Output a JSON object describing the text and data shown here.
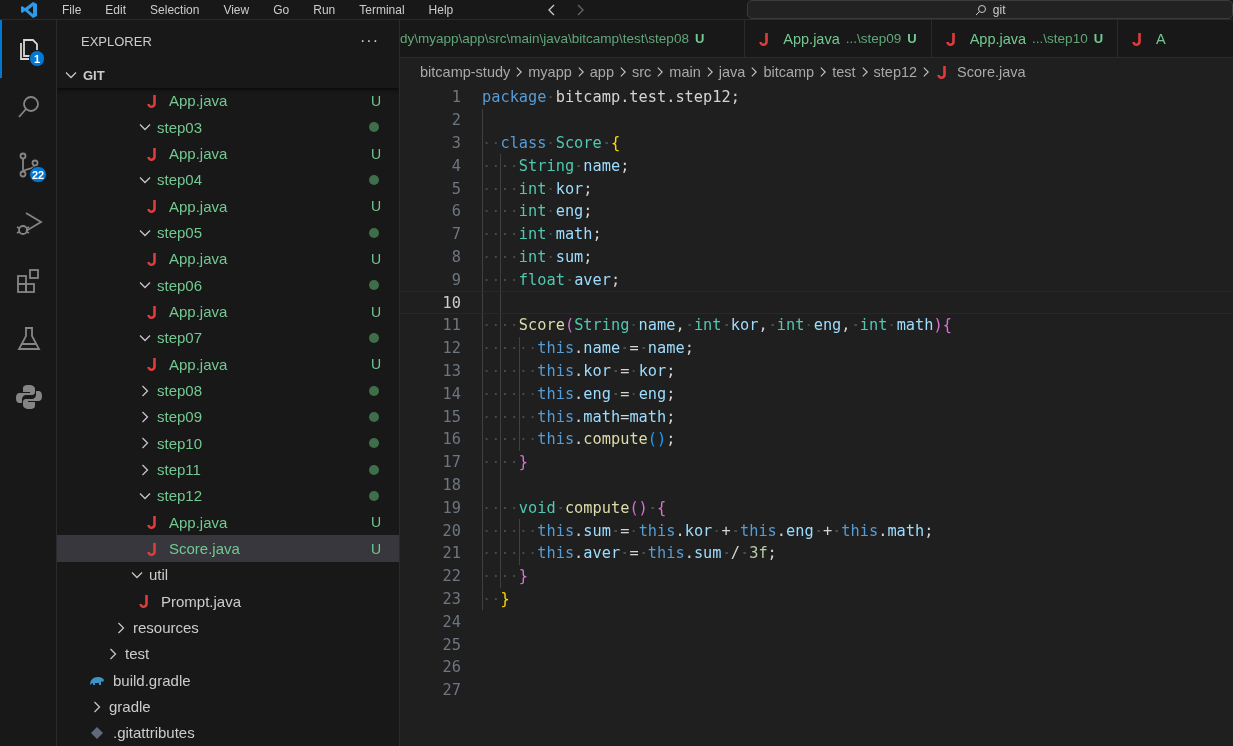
{
  "menu": [
    "File",
    "Edit",
    "Selection",
    "View",
    "Go",
    "Run",
    "Terminal",
    "Help"
  ],
  "search": {
    "value": "git"
  },
  "activity": [
    {
      "kind": "explorer",
      "selected": true,
      "badge": "1"
    },
    {
      "kind": "search",
      "selected": false
    },
    {
      "kind": "source-control",
      "selected": false,
      "badge": "22"
    },
    {
      "kind": "run",
      "selected": false
    },
    {
      "kind": "extensions",
      "selected": false
    },
    {
      "kind": "testing",
      "selected": false
    },
    {
      "kind": "python",
      "selected": false
    }
  ],
  "sidebar": {
    "title": "EXPLORER",
    "more": "···",
    "section": {
      "label": "GIT",
      "expanded": true
    },
    "tree": [
      {
        "children": [
          {
            "children": [
              {
                "children": [
                  {
                    "children": [
                      {
                        "children": [
                          {
                            "children": [
                              {
                                "children": [
                                  {
                                    "name": "App.java",
                                    "kind": "java",
                                    "untracked": true,
                                    "badge": "U",
                                    "selected": false
                                  }
                                ]
                              },
                              {
                                "name": "step03",
                                "kind": "folder",
                                "expanded": true,
                                "untracked": true,
                                "modified": true,
                                "selected": false,
                                "children": [
                                  {
                                    "name": "App.java",
                                    "kind": "java",
                                    "untracked": true,
                                    "badge": "U",
                                    "selected": false
                                  }
                                ]
                              },
                              {
                                "name": "step04",
                                "kind": "folder",
                                "expanded": true,
                                "untracked": true,
                                "modified": true,
                                "selected": false,
                                "children": [
                                  {
                                    "name": "App.java",
                                    "kind": "java",
                                    "untracked": true,
                                    "badge": "U",
                                    "selected": false
                                  }
                                ]
                              },
                              {
                                "name": "step05",
                                "kind": "folder",
                                "expanded": true,
                                "untracked": true,
                                "modified": true,
                                "selected": false,
                                "children": [
                                  {
                                    "name": "App.java",
                                    "kind": "java",
                                    "untracked": true,
                                    "badge": "U",
                                    "selected": false
                                  }
                                ]
                              },
                              {
                                "name": "step06",
                                "kind": "folder",
                                "expanded": true,
                                "untracked": true,
                                "modified": true,
                                "selected": false,
                                "children": [
                                  {
                                    "name": "App.java",
                                    "kind": "java",
                                    "untracked": true,
                                    "badge": "U",
                                    "selected": false
                                  }
                                ]
                              },
                              {
                                "name": "step07",
                                "kind": "folder",
                                "expanded": true,
                                "untracked": true,
                                "modified": true,
                                "selected": false,
                                "children": [
                                  {
                                    "name": "App.java",
                                    "kind": "java",
                                    "untracked": true,
                                    "badge": "U",
                                    "selected": false
                                  }
                                ]
                              },
                              {
                                "name": "step08",
                                "kind": "folder",
                                "expanded": false,
                                "untracked": true,
                                "modified": true,
                                "selected": false
                              },
                              {
                                "name": "step09",
                                "kind": "folder",
                                "expanded": false,
                                "untracked": true,
                                "modified": true,
                                "selected": false
                              },
                              {
                                "name": "step10",
                                "kind": "folder",
                                "expanded": false,
                                "untracked": true,
                                "modified": true,
                                "selected": false
                              },
                              {
                                "name": "step11",
                                "kind": "folder",
                                "expanded": false,
                                "untracked": true,
                                "modified": true,
                                "selected": false
                              },
                              {
                                "name": "step12",
                                "kind": "folder",
                                "expanded": true,
                                "untracked": true,
                                "modified": true,
                                "selected": false,
                                "children": [
                                  {
                                    "name": "App.java",
                                    "kind": "java",
                                    "untracked": true,
                                    "badge": "U",
                                    "selected": false
                                  },
                                  {
                                    "name": "Score.java",
                                    "kind": "java",
                                    "untracked": true,
                                    "badge": "U",
                                    "selected": true
                                  }
                                ]
                              }
                            ]
                          },
                          {
                            "name": "util",
                            "kind": "folder",
                            "expanded": true,
                            "untracked": false,
                            "selected": false,
                            "children": [
                              {
                                "name": "Prompt.java",
                                "kind": "java",
                                "untracked": false,
                                "selected": false
                              }
                            ]
                          }
                        ]
                      }
                    ]
                  },
                  {
                    "name": "resources",
                    "kind": "folder",
                    "expanded": false,
                    "untracked": false,
                    "selected": false
                  }
                ]
              },
              {
                "name": "test",
                "kind": "folder",
                "expanded": false,
                "untracked": false,
                "selected": false
              }
            ]
          }
        ]
      },
      {
        "name": "build.gradle",
        "kind": "gradle",
        "untracked": false,
        "selected": false
      },
      {
        "name": "gradle",
        "kind": "folder",
        "expanded": false,
        "untracked": false,
        "selected": false
      },
      {
        "name": ".gitattributes",
        "kind": "git",
        "untracked": false,
        "selected": false
      }
    ]
  },
  "tabs": [
    {
      "description": "dy\\myapp\\app\\src\\main\\java\\bitcamp\\test\\step08",
      "badge": "U",
      "selected": false
    },
    {
      "label": "App.java",
      "description": "...\\step09",
      "badge": "U",
      "selected": false
    },
    {
      "label": "App.java",
      "description": "...\\step10",
      "badge": "U",
      "selected": false
    },
    {
      "label": "A",
      "selected": false
    }
  ],
  "breadcrumbs": [
    "bitcamp-study",
    "myapp",
    "app",
    "src",
    "main",
    "java",
    "bitcamp",
    "test",
    "step12",
    "Score.java"
  ],
  "code": [
    {
      "n": "1",
      "current": false,
      "segments": [
        {
          "text": "package",
          "color": "#569cd6"
        },
        {
          "text": " bitcamp.test.step12;"
        }
      ]
    },
    {
      "n": "2",
      "current": false
    },
    {
      "n": "3",
      "current": false,
      "segments": [
        {
          "text": "  class",
          "color": "#569cd6"
        },
        {
          "text": " Score",
          "color": "#4ec9b0"
        },
        {
          "text": " {",
          "color": "#ffd700"
        }
      ]
    },
    {
      "n": "4",
      "current": false,
      "segments": [
        {
          "text": "    String",
          "color": "#4ec9b0"
        },
        {
          "text": " name",
          "color": "#9cdcfe"
        },
        {
          "text": ";"
        }
      ]
    },
    {
      "n": "5",
      "current": false,
      "segments": [
        {
          "text": "    int",
          "color": "#4ec9b0"
        },
        {
          "text": " kor",
          "color": "#9cdcfe"
        },
        {
          "text": ";"
        }
      ]
    },
    {
      "n": "6",
      "current": false,
      "segments": [
        {
          "text": "    int",
          "color": "#4ec9b0"
        },
        {
          "text": " eng",
          "color": "#9cdcfe"
        },
        {
          "text": ";"
        }
      ]
    },
    {
      "n": "7",
      "current": false,
      "segments": [
        {
          "text": "    int",
          "color": "#4ec9b0"
        },
        {
          "text": " math",
          "color": "#9cdcfe"
        },
        {
          "text": ";"
        }
      ]
    },
    {
      "n": "8",
      "current": false,
      "segments": [
        {
          "text": "    int",
          "color": "#4ec9b0"
        },
        {
          "text": " sum",
          "color": "#9cdcfe"
        },
        {
          "text": ";"
        }
      ]
    },
    {
      "n": "9",
      "current": false,
      "segments": [
        {
          "text": "    float",
          "color": "#4ec9b0"
        },
        {
          "text": " aver",
          "color": "#9cdcfe"
        },
        {
          "text": ";"
        }
      ]
    },
    {
      "n": "10",
      "current": true
    },
    {
      "n": "11",
      "current": false,
      "segments": [
        {
          "text": "    Score",
          "color": "#dcdcaa"
        },
        {
          "text": "(",
          "color": "#da70d6"
        },
        {
          "text": "String",
          "color": "#4ec9b0"
        },
        {
          "text": " name",
          "color": "#9cdcfe"
        },
        {
          "text": ", "
        },
        {
          "text": "int",
          "color": "#4ec9b0"
        },
        {
          "text": " kor",
          "color": "#9cdcfe"
        },
        {
          "text": ", "
        },
        {
          "text": "int",
          "color": "#4ec9b0"
        },
        {
          "text": " eng",
          "color": "#9cdcfe"
        },
        {
          "text": ", "
        },
        {
          "text": "int",
          "color": "#4ec9b0"
        },
        {
          "text": " math",
          "color": "#9cdcfe"
        },
        {
          "text": "){",
          "color": "#da70d6"
        }
      ]
    },
    {
      "n": "12",
      "current": false,
      "segments": [
        {
          "text": "      this",
          "color": "#569cd6"
        },
        {
          "text": "."
        },
        {
          "text": "name",
          "color": "#9cdcfe"
        },
        {
          "text": " = "
        },
        {
          "text": "name",
          "color": "#9cdcfe"
        },
        {
          "text": ";"
        }
      ]
    },
    {
      "n": "13",
      "current": false,
      "segments": [
        {
          "text": "      this",
          "color": "#569cd6"
        },
        {
          "text": "."
        },
        {
          "text": "kor",
          "color": "#9cdcfe"
        },
        {
          "text": " = "
        },
        {
          "text": "kor",
          "color": "#9cdcfe"
        },
        {
          "text": ";"
        }
      ]
    },
    {
      "n": "14",
      "current": false,
      "segments": [
        {
          "text": "      this",
          "color": "#569cd6"
        },
        {
          "text": "."
        },
        {
          "text": "eng",
          "color": "#9cdcfe"
        },
        {
          "text": " = "
        },
        {
          "text": "eng",
          "color": "#9cdcfe"
        },
        {
          "text": ";"
        }
      ]
    },
    {
      "n": "15",
      "current": false,
      "segments": [
        {
          "text": "      this",
          "color": "#569cd6"
        },
        {
          "text": "."
        },
        {
          "text": "math",
          "color": "#9cdcfe"
        },
        {
          "text": "="
        },
        {
          "text": "math",
          "color": "#9cdcfe"
        },
        {
          "text": ";"
        }
      ]
    },
    {
      "n": "16",
      "current": false,
      "segments": [
        {
          "text": "      this",
          "color": "#569cd6"
        },
        {
          "text": "."
        },
        {
          "text": "compute",
          "color": "#dcdcaa"
        },
        {
          "text": "()",
          "color": "#179fff"
        },
        {
          "text": ";"
        }
      ]
    },
    {
      "n": "17",
      "current": false,
      "segments": [
        {
          "text": "    }",
          "color": "#da70d6"
        }
      ]
    },
    {
      "n": "18",
      "current": false
    },
    {
      "n": "19",
      "current": false,
      "segments": [
        {
          "text": "    void",
          "color": "#4ec9b0"
        },
        {
          "text": " compute",
          "color": "#dcdcaa"
        },
        {
          "text": "() {",
          "color": "#da70d6"
        }
      ]
    },
    {
      "n": "20",
      "current": false,
      "segments": [
        {
          "text": "      this",
          "color": "#569cd6"
        },
        {
          "text": "."
        },
        {
          "text": "sum",
          "color": "#9cdcfe"
        },
        {
          "text": " = "
        },
        {
          "text": "this",
          "color": "#569cd6"
        },
        {
          "text": "."
        },
        {
          "text": "kor",
          "color": "#9cdcfe"
        },
        {
          "text": " + "
        },
        {
          "text": "this",
          "color": "#569cd6"
        },
        {
          "text": "."
        },
        {
          "text": "eng",
          "color": "#9cdcfe"
        },
        {
          "text": " + "
        },
        {
          "text": "this",
          "color": "#569cd6"
        },
        {
          "text": "."
        },
        {
          "text": "math",
          "color": "#9cdcfe"
        },
        {
          "text": ";"
        }
      ]
    },
    {
      "n": "21",
      "current": false,
      "segments": [
        {
          "text": "      this",
          "color": "#569cd6"
        },
        {
          "text": "."
        },
        {
          "text": "aver",
          "color": "#9cdcfe"
        },
        {
          "text": " = "
        },
        {
          "text": "this",
          "color": "#569cd6"
        },
        {
          "text": "."
        },
        {
          "text": "sum",
          "color": "#9cdcfe"
        },
        {
          "text": " / "
        },
        {
          "text": "3f",
          "color": "#b5cea8"
        },
        {
          "text": ";"
        }
      ]
    },
    {
      "n": "22",
      "current": false,
      "segments": [
        {
          "text": "    }",
          "color": "#da70d6"
        }
      ]
    },
    {
      "n": "23",
      "current": false,
      "segments": [
        {
          "text": "  }",
          "color": "#ffd700"
        }
      ]
    },
    {
      "n": "24",
      "current": false
    },
    {
      "n": "25",
      "current": false
    },
    {
      "n": "26",
      "current": false
    },
    {
      "n": "27",
      "current": false
    }
  ]
}
